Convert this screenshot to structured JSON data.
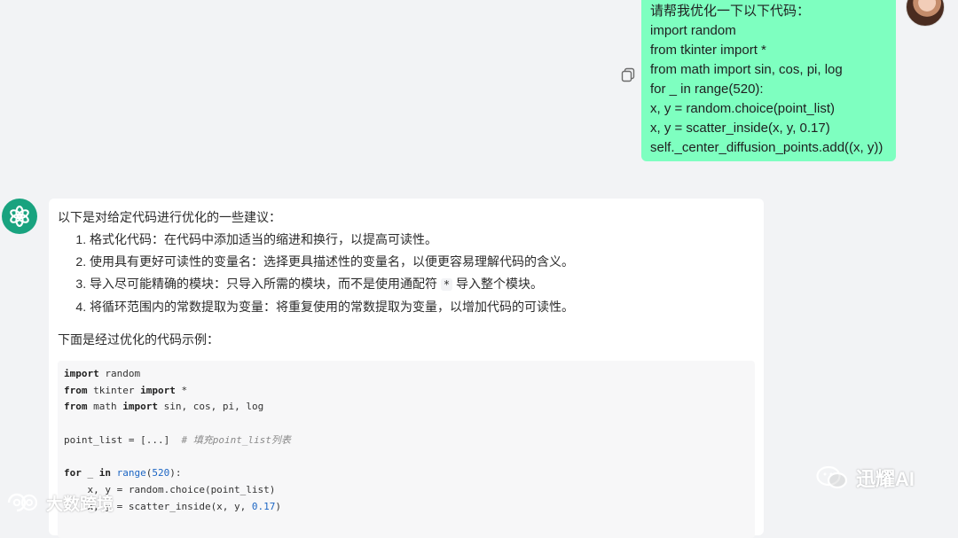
{
  "user_message": {
    "lines": [
      "请帮我优化一下以下代码：",
      "import random",
      "from tkinter import *",
      "from math import sin, cos, pi, log",
      "for _ in range(520):",
      "x, y = random.choice(point_list)",
      "x, y = scatter_inside(x, y, 0.17)",
      "self._center_diffusion_points.add((x, y))"
    ],
    "bubble_color": "#7effc0"
  },
  "assistant": {
    "intro": "以下是对给定代码进行优化的一些建议：",
    "tips": [
      "格式化代码：在代码中添加适当的缩进和换行，以提高可读性。",
      "使用具有更好可读性的变量名：选择更具描述性的变量名，以便更容易理解代码的含义。",
      {
        "before": "导入尽可能精确的模块：只导入所需的模块，而不是使用通配符",
        "code": "*",
        "after": "导入整个模块。"
      },
      "将循环范围内的常数提取为变量：将重复使用的常数提取为变量，以增加代码的可读性。"
    ],
    "after_tips": "下面是经过优化的代码示例：",
    "code": {
      "line1_kw": "import",
      "line1_rest": " random",
      "line2_kw1": "from",
      "line2_mid": " tkinter ",
      "line2_kw2": "import",
      "line2_rest": " *",
      "line3_kw1": "from",
      "line3_mid": " math ",
      "line3_kw2": "import",
      "line3_rest": " sin, cos, pi, log",
      "line5_code": "point_list = [...]  ",
      "line5_comment": "# 填充point_list列表",
      "line7_kw1": "for",
      "line7_a": " _ ",
      "line7_kw2": "in",
      "line7_b": " ",
      "line7_bi": "range",
      "line7_c": "(",
      "line7_num": "520",
      "line7_d": "):",
      "line8": "    x, y = random.choice(point_list)",
      "line9_a": "    x, y = scatter_inside(x, y, ",
      "line9_num": "0.17",
      "line9_b": ")"
    },
    "accent_color": "#19a37f"
  },
  "watermarks": {
    "right": "迅耀AI",
    "left": "大数跨境"
  },
  "icons": {
    "copy": "copy-icon",
    "assistant_logo": "openai-logo-icon",
    "wechat": "wechat-icon",
    "left_mark": "crossborder-logo-icon"
  }
}
